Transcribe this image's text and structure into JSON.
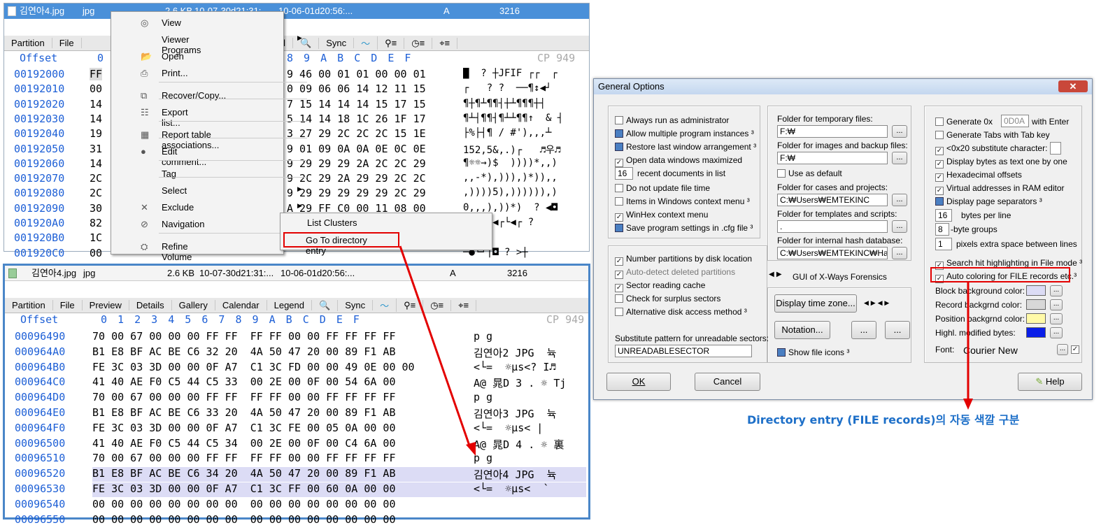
{
  "top": {
    "file_row": {
      "name": "김연아4.jpg",
      "ext": "jpg",
      "size": "2.6 KB",
      "created": "10-07-30d21:31:",
      "modified": "10-06-01d20:56:...",
      "attr": "A",
      "sector": "3216"
    },
    "tabs_left": [
      "Partition",
      "File"
    ],
    "tabs_right": [
      "Legend",
      "Sync"
    ],
    "offset_header": "Offset",
    "col0": "0",
    "hex_header": "8  9  A  B  C  D  E  F",
    "codepage": "CP 949",
    "offsets": [
      "00192000",
      "00192010",
      "00192020",
      "00192030",
      "00192040",
      "00192050",
      "00192060",
      "00192070",
      "00192080",
      "00192090",
      "001920A0",
      "001920B0",
      "001920C0"
    ],
    "col0_vals": [
      "FF",
      "00",
      "14",
      "14",
      "19",
      "31",
      "14",
      "2C",
      "2C",
      "30",
      "82",
      "1C",
      "00"
    ],
    "hex": [
      "9 46 00 01 01 00 00 01",
      "0 09 06 06 14 12 11 15",
      "7 15 14 14 14 15 17 15",
      "5 14 14 18 1C 26 1F 17",
      "3 27 29 2C 2C 2C 15 1E",
      "9 01 09 0A 0A 0E 0C 0E",
      "9 29 29 29 2A 2C 2C 29",
      "9 2C 29 2A 29 29 2C 2C",
      "9 29 29 29 29 29 2C 29",
      "A 29 FF C0 00 11 08 00",
      "",
      "",
      ""
    ],
    "text": [
      "█  ? ┼JFIF ┌┌  ┌",
      "┌   ? ?  ──¶↕◀┘",
      "¶┼¶┴¶¶┤┼┴¶¶¶┼┤",
      "¶┴┤¶¶┤¶┴┴¶¶↑  & ┤",
      "├%├┤¶ / #'),,,┴",
      "152,5&,.)┌   ♬우♬",
      "¶☼☼→)$  ))))*,,)",
      ",,-*),))),)*)),,",
      ",))))5),)))))),)",
      "0,,,),))*)  ? ◀◘",
      "┌\"  ┐◀┌└◀┌ ?",
      "┐ └┌",
      "─●└┘|◘ ? >┼"
    ]
  },
  "context_menu": {
    "items": [
      "View",
      "Viewer Programs",
      "Open",
      "Print...",
      "Recover/Copy...",
      "Export list...",
      "Report table associations...",
      "Edit comment...",
      "Tag",
      "Select",
      "Exclude",
      "Navigation",
      "Refine Volume Snapshot..."
    ],
    "submenu": [
      "List Clusters",
      "Go To directory entry"
    ]
  },
  "bottom": {
    "file_row": {
      "name": "김연아4.jpg",
      "ext": "jpg",
      "size": "2.6 KB",
      "created": "10-07-30d21:31:...",
      "modified": "10-06-01d20:56:...",
      "attr": "A",
      "sector": "3216"
    },
    "tabs": [
      "Partition",
      "File",
      "Preview",
      "Details",
      "Gallery",
      "Calendar",
      "Legend",
      "Sync"
    ],
    "offset_header": "Offset",
    "hex_header": "0  1  2  3  4  5  6  7   8  9  A  B  C  D  E  F",
    "codepage": "CP 949",
    "offsets": [
      "00096490",
      "000964A0",
      "000964B0",
      "000964C0",
      "000964D0",
      "000964E0",
      "000964F0",
      "00096500",
      "00096510",
      "00096520",
      "00096530",
      "00096540",
      "00096550"
    ],
    "hex": [
      "70 00 67 00 00 00 FF FF  FF FF 00 00 FF FF FF FF",
      "B1 E8 BF AC BE C6 32 20  4A 50 47 20 00 89 F1 AB",
      "FE 3C 03 3D 00 00 0F A7  C1 3C FD 00 00 49 0E 00 00",
      "41 40 AE F0 C5 44 C5 33  00 2E 00 0F 00 54 6A 00",
      "70 00 67 00 00 00 FF FF  FF FF 00 00 FF FF FF FF",
      "B1 E8 BF AC BE C6 33 20  4A 50 47 20 00 89 F1 AB",
      "FE 3C 03 3D 00 00 0F A7  C1 3C FE 00 05 0A 00 00",
      "41 40 AE F0 C5 44 C5 34  00 2E 00 0F 00 C4 6A 00",
      "70 00 67 00 00 00 FF FF  FF FF 00 00 FF FF FF FF",
      "B1 E8 BF AC BE C6 34 20  4A 50 47 20 00 89 F1 AB",
      "FE 3C 03 3D 00 00 0F A7  C1 3C FF 00 60 0A 00 00",
      "00 00 00 00 00 00 00 00  00 00 00 00 00 00 00 00",
      "00 00 00 00 00 00 00 00  00 00 00 00 00 00 00 00"
    ],
    "text": [
      "p g",
      "김연아2 JPG  뉵",
      "<└=  ☼µs<? I♬",
      "A@ 晁D 3 . ☼ Tj",
      "p g",
      "김연아3 JPG  뉵",
      "<└=  ☼µs< |",
      "A@ 晁D 4 . ☼ 裏",
      "p g",
      "김연아4 JPG  뉵",
      "<└=  ☼µs<  `",
      "",
      ""
    ]
  },
  "dialog": {
    "title": "General Options",
    "col1": [
      "Always run as administrator",
      "Allow multiple program instances ³",
      "Restore last window arrangement ³",
      "Open data windows maximized",
      "recent documents in list",
      "Do not update file time",
      "Items in Windows context menu ³",
      "WinHex context menu",
      "Save program settings in .cfg file ³"
    ],
    "recent_docs": "16",
    "col1b": [
      "Number partitions by disk location",
      "Auto-detect deleted partitions",
      "Sector reading cache",
      "Check for surplus sectors",
      "Alternative disk access method ³"
    ],
    "subst_label": "Substitute pattern for unreadable sectors:",
    "subst_value": "UNREADABLESECTOR",
    "col2_labels": [
      "Folder for temporary files:",
      "Folder for images and backup files:",
      "Use as default",
      "Folder for cases and projects:",
      "Folder for templates and scripts:",
      "Folder for internal hash database:"
    ],
    "col2_values": [
      "F:₩",
      "F:₩",
      "C:₩Users₩EMTEKINC",
      "C:₩Users₩EMTEKINC₩Hasl"
    ],
    "template_value": ".",
    "gui_label": "GUI of X-Ways Forensics",
    "display_tz": "Display time zone...",
    "notation": "Notation...",
    "ellipsis": "...",
    "show_icons": "Show file icons ³",
    "col3": [
      "Generate 0x",
      "with Enter",
      "Generate Tabs with Tab key",
      "<0x20 substitute character:",
      "Display bytes as text one by one",
      "Hexadecimal offsets",
      "Virtual addresses in RAM editor",
      "Display page separators ³",
      "bytes per line",
      "-byte groups",
      "pixels extra space between lines",
      "Search hit highlighting in File mode ³",
      "Auto coloring for FILE records etc.³"
    ],
    "gen_value": "0D0A",
    "bpl": "16",
    "groups": "8",
    "pix": "1",
    "colors": [
      "Block background color:",
      "Record backgrnd color:",
      "Position backgrnd color:",
      "Highl. modified bytes:"
    ],
    "font_label": "Font:",
    "font_value": "Courier New",
    "ok": "OK",
    "cancel": "Cancel",
    "help": "Help"
  },
  "caption": "Directory entry (FILE records)의 자동 색깔 구분",
  "colors": {
    "accent": "#1d5fd6",
    "highlight": "#e30000",
    "selection": "#dcdcf5",
    "dialog_bg": "#f0f0f0"
  }
}
